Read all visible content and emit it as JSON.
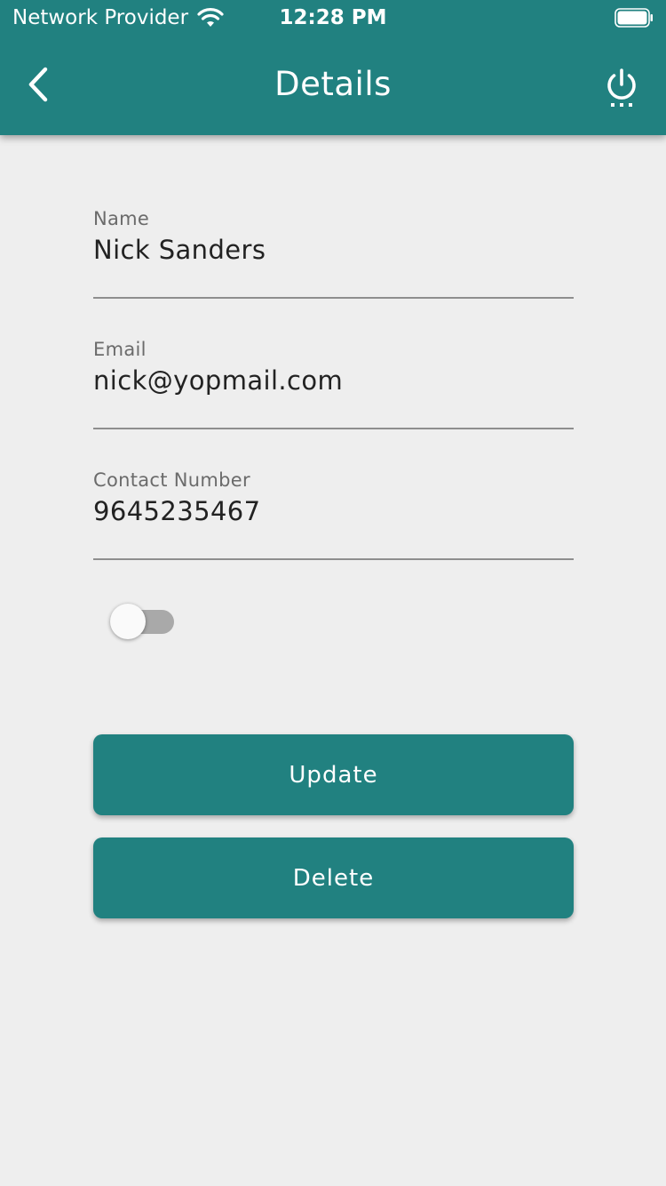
{
  "status_bar": {
    "carrier": "Network Provider",
    "time": "12:28 PM"
  },
  "toolbar": {
    "title": "Details",
    "back_icon": "chevron-left-icon",
    "power_icon": "power-icon"
  },
  "form": {
    "name_label": "Name",
    "name_value": "Nick Sanders",
    "email_label": "Email",
    "email_value": "nick@yopmail.com",
    "contact_label": "Contact Number",
    "contact_value": "9645235467"
  },
  "toggle": {
    "on": false
  },
  "buttons": {
    "update_label": "Update",
    "delete_label": "Delete"
  },
  "colors": {
    "primary": "#218180",
    "background": "#eeeeee"
  }
}
